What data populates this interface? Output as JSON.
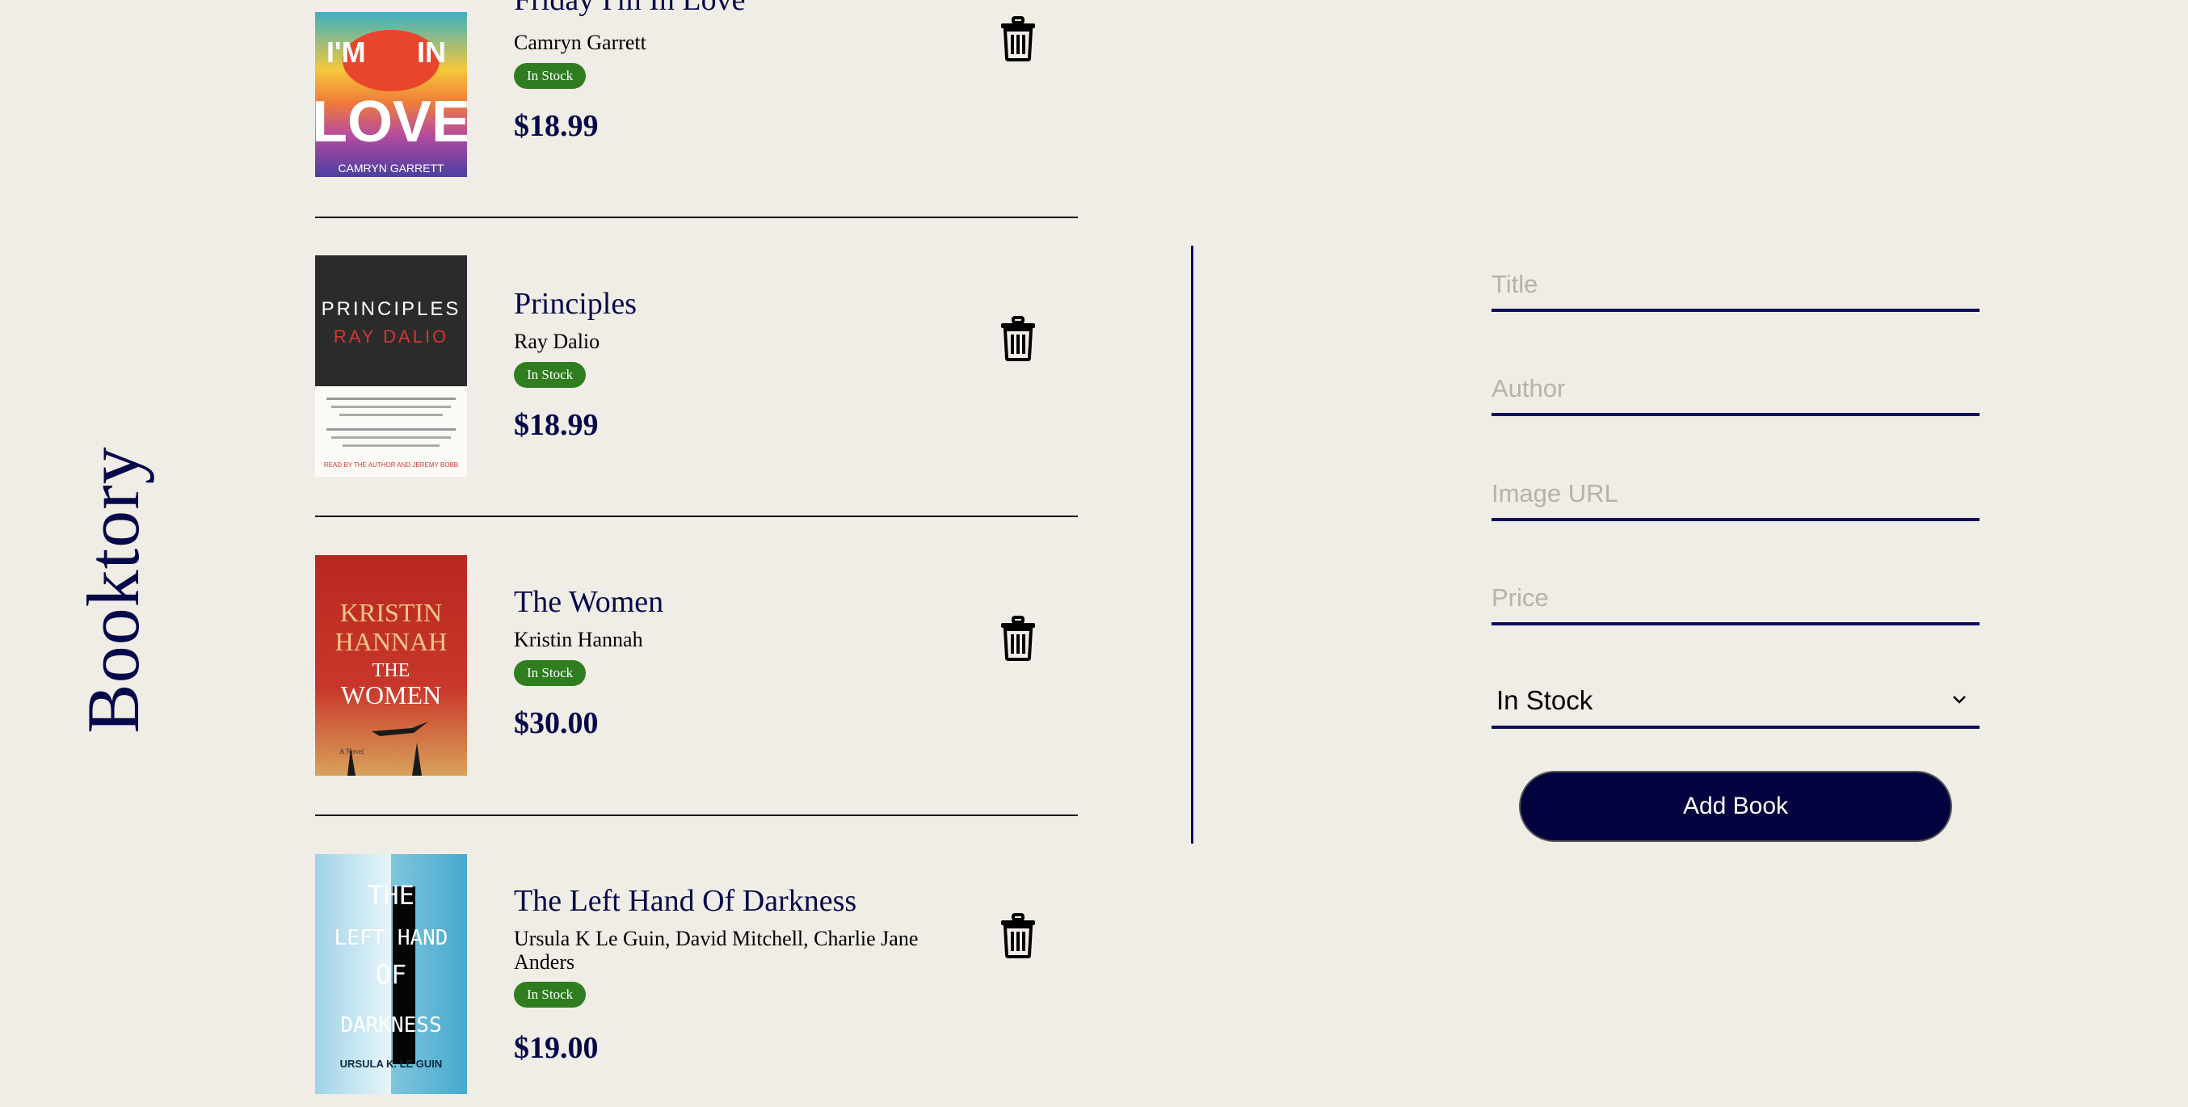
{
  "brand": {
    "name": "Booktory"
  },
  "books": [
    {
      "title": "Friday I'm In Love",
      "author": "Camryn Garrett",
      "status": "In Stock",
      "price": "$18.99",
      "cover": {
        "lines": [
          "I'M",
          "IN",
          "LOVE"
        ],
        "byline": "CAMRYN GARRETT"
      }
    },
    {
      "title": "Principles",
      "author": "Ray Dalio",
      "status": "In Stock",
      "price": "$18.99",
      "cover": {
        "lines": [
          "PRINCIPLES",
          "RAY DALIO"
        ],
        "byline": "READ BY THE AUTHOR AND JEREMY BOBB"
      }
    },
    {
      "title": "The Women",
      "author": "Kristin Hannah",
      "status": "In Stock",
      "price": "$30.00",
      "cover": {
        "lines": [
          "KRISTIN",
          "HANNAH",
          "THE",
          "WOMEN"
        ],
        "byline": "A Novel"
      }
    },
    {
      "title": "The Left Hand Of Darkness",
      "author": "Ursula K Le Guin, David Mitchell, Charlie Jane Anders",
      "status": "In Stock",
      "price": "$19.00",
      "cover": {
        "lines": [
          "THE",
          "LEFT HAND",
          "OF",
          "DARKNESS"
        ],
        "byline": "URSULA K. LE GUIN"
      }
    }
  ],
  "form": {
    "title_placeholder": "Title",
    "author_placeholder": "Author",
    "image_placeholder": "Image URL",
    "price_placeholder": "Price",
    "status_value": "In Stock",
    "submit_label": "Add Book"
  },
  "colors": {
    "background": "#f0ede6",
    "navy": "#05084a",
    "badge_green": "#2f7d1f"
  },
  "icons": {
    "delete": "trash-icon",
    "select": "chevron-down-icon"
  }
}
